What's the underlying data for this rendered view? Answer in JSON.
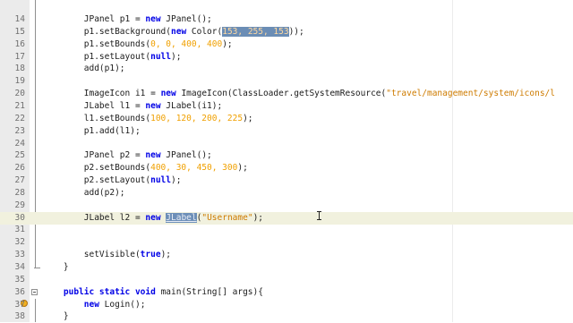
{
  "editor": {
    "lines": [
      {
        "n": "14",
        "tokens": [
          {
            "t": "        JPanel p1 = "
          },
          {
            "t": "new",
            "c": "kw"
          },
          {
            "t": " JPanel();"
          }
        ]
      },
      {
        "n": "15",
        "tokens": [
          {
            "t": "        p1.setBackground("
          },
          {
            "t": "new",
            "c": "kw"
          },
          {
            "t": " Color("
          },
          {
            "t": "153, 255, 153",
            "c": "num sel"
          },
          {
            "t": "));"
          }
        ]
      },
      {
        "n": "16",
        "tokens": [
          {
            "t": "        p1.setBounds("
          },
          {
            "t": "0, 0, 400, 400",
            "c": "num"
          },
          {
            "t": ");"
          }
        ]
      },
      {
        "n": "17",
        "tokens": [
          {
            "t": "        p1.setLayout("
          },
          {
            "t": "null",
            "c": "kw"
          },
          {
            "t": ");"
          }
        ]
      },
      {
        "n": "18",
        "tokens": [
          {
            "t": "        add(p1);"
          }
        ]
      },
      {
        "n": "19",
        "tokens": [
          {
            "t": ""
          }
        ]
      },
      {
        "n": "20",
        "tokens": [
          {
            "t": "        ImageIcon i1 = "
          },
          {
            "t": "new",
            "c": "kw"
          },
          {
            "t": " ImageIcon(ClassLoader.getSystemResource("
          },
          {
            "t": "\"travel/management/system/icons/l",
            "c": "str"
          }
        ]
      },
      {
        "n": "21",
        "tokens": [
          {
            "t": "        JLabel l1 = "
          },
          {
            "t": "new",
            "c": "kw"
          },
          {
            "t": " JLabel(i1);"
          }
        ]
      },
      {
        "n": "22",
        "tokens": [
          {
            "t": "        l1.setBounds("
          },
          {
            "t": "100, 120, 200, 225",
            "c": "num"
          },
          {
            "t": ");"
          }
        ]
      },
      {
        "n": "23",
        "tokens": [
          {
            "t": "        p1.add(l1);"
          }
        ]
      },
      {
        "n": "24",
        "tokens": [
          {
            "t": ""
          }
        ]
      },
      {
        "n": "25",
        "tokens": [
          {
            "t": "        JPanel p2 = "
          },
          {
            "t": "new",
            "c": "kw"
          },
          {
            "t": " JPanel();"
          }
        ]
      },
      {
        "n": "26",
        "tokens": [
          {
            "t": "        p2.setBounds("
          },
          {
            "t": "400, 30, 450, 300",
            "c": "num"
          },
          {
            "t": ");"
          }
        ]
      },
      {
        "n": "27",
        "tokens": [
          {
            "t": "        p2.setLayout("
          },
          {
            "t": "null",
            "c": "kw"
          },
          {
            "t": ");"
          }
        ]
      },
      {
        "n": "28",
        "tokens": [
          {
            "t": "        add(p2);"
          }
        ]
      },
      {
        "n": "29",
        "tokens": [
          {
            "t": ""
          }
        ]
      },
      {
        "n": "30",
        "current": true,
        "tokens": [
          {
            "t": "        JLabel l2 = "
          },
          {
            "t": "new",
            "c": "kw"
          },
          {
            "t": " "
          },
          {
            "t": "JLabel",
            "c": "hl"
          },
          {
            "t": "("
          },
          {
            "t": "\"Username\"",
            "c": "str"
          },
          {
            "t": ");"
          }
        ]
      },
      {
        "n": "31",
        "tokens": [
          {
            "t": ""
          }
        ]
      },
      {
        "n": "32",
        "tokens": [
          {
            "t": ""
          }
        ]
      },
      {
        "n": "33",
        "tokens": [
          {
            "t": "        setVisible("
          },
          {
            "t": "true",
            "c": "kw"
          },
          {
            "t": ");"
          }
        ]
      },
      {
        "n": "34",
        "tokens": [
          {
            "t": "    }"
          }
        ]
      },
      {
        "n": "35",
        "tokens": [
          {
            "t": ""
          }
        ]
      },
      {
        "n": "36",
        "tokens": [
          {
            "t": "    "
          },
          {
            "t": "public static void",
            "c": "kw"
          },
          {
            "t": " main(String[] args){"
          }
        ]
      },
      {
        "n": "37",
        "tokens": [
          {
            "t": "        "
          },
          {
            "t": "new",
            "c": "kw"
          },
          {
            "t": " Login();"
          }
        ]
      },
      {
        "n": "38",
        "tokens": [
          {
            "t": "    }"
          }
        ]
      }
    ]
  }
}
